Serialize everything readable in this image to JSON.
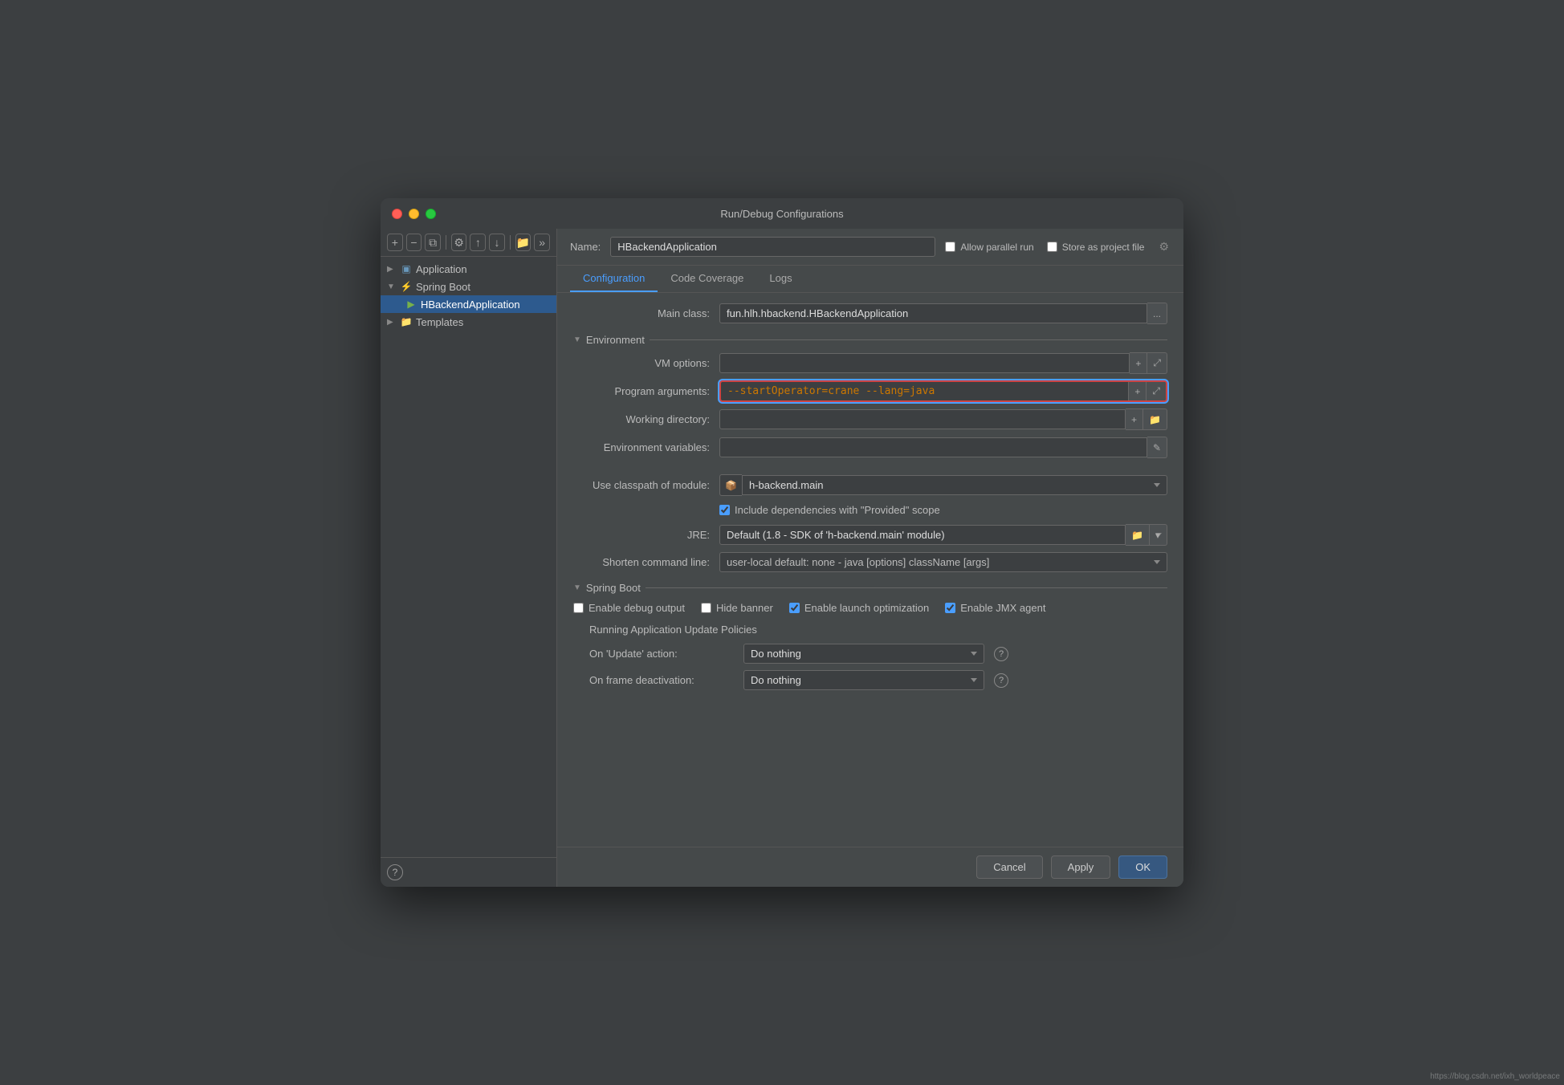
{
  "window": {
    "title": "Run/Debug Configurations"
  },
  "sidebar": {
    "toolbar": {
      "add_label": "+",
      "remove_label": "−",
      "copy_label": "⧉",
      "wrench_label": "⚙",
      "up_label": "↑",
      "down_label": "↓",
      "folder_label": "📁",
      "more_label": "»"
    },
    "items": [
      {
        "label": "Application",
        "level": 0,
        "has_arrow": true,
        "icon": "▶",
        "icon_type": "app"
      },
      {
        "label": "Spring Boot",
        "level": 0,
        "has_arrow": true,
        "icon": "⚡",
        "icon_type": "springboot"
      },
      {
        "label": "HBackendApplication",
        "level": 1,
        "has_arrow": false,
        "icon": "▶",
        "icon_type": "run",
        "selected": true
      },
      {
        "label": "Templates",
        "level": 0,
        "has_arrow": true,
        "icon": "📁",
        "icon_type": "folder"
      }
    ],
    "help_label": "?"
  },
  "name_bar": {
    "name_label": "Name:",
    "name_value": "HBackendApplication",
    "allow_parallel_label": "Allow parallel run",
    "store_as_project_label": "Store as project file",
    "gear_icon": "⚙"
  },
  "tabs": [
    {
      "label": "Configuration",
      "active": true
    },
    {
      "label": "Code Coverage",
      "active": false
    },
    {
      "label": "Logs",
      "active": false
    }
  ],
  "configuration": {
    "main_class_label": "Main class:",
    "main_class_value": "fun.hlh.hbackend.HBackendApplication",
    "more_btn_label": "...",
    "environment_section": "Environment",
    "vm_options_label": "VM options:",
    "vm_options_value": "",
    "program_args_label": "Program arguments:",
    "program_args_value": "--startOperator=crane --lang=java",
    "working_dir_label": "Working directory:",
    "working_dir_value": "",
    "env_vars_label": "Environment variables:",
    "env_vars_value": "",
    "classpath_label": "Use classpath of module:",
    "classpath_value": "h-backend.main",
    "include_deps_label": "Include dependencies with \"Provided\" scope",
    "include_deps_checked": true,
    "jre_label": "JRE:",
    "jre_value": "Default (1.8 - SDK of 'h-backend.main' module)",
    "shorten_cmd_label": "Shorten command line:",
    "shorten_cmd_value": "user-local default: none - java [options] className [args]",
    "springboot_section": "Spring Boot",
    "enable_debug_label": "Enable debug output",
    "enable_debug_checked": false,
    "hide_banner_label": "Hide banner",
    "hide_banner_checked": false,
    "enable_launch_label": "Enable launch optimization",
    "enable_launch_checked": true,
    "enable_jmx_label": "Enable JMX agent",
    "enable_jmx_checked": true,
    "update_policies_label": "Running Application Update Policies",
    "on_update_label": "On 'Update' action:",
    "on_update_value": "Do nothing",
    "on_frame_label": "On frame deactivation:",
    "on_frame_value": "Do nothing"
  },
  "bottom_bar": {
    "cancel_label": "Cancel",
    "apply_label": "Apply",
    "ok_label": "OK"
  },
  "watermark": "https://blog.csdn.net/ixh_worldpeace"
}
